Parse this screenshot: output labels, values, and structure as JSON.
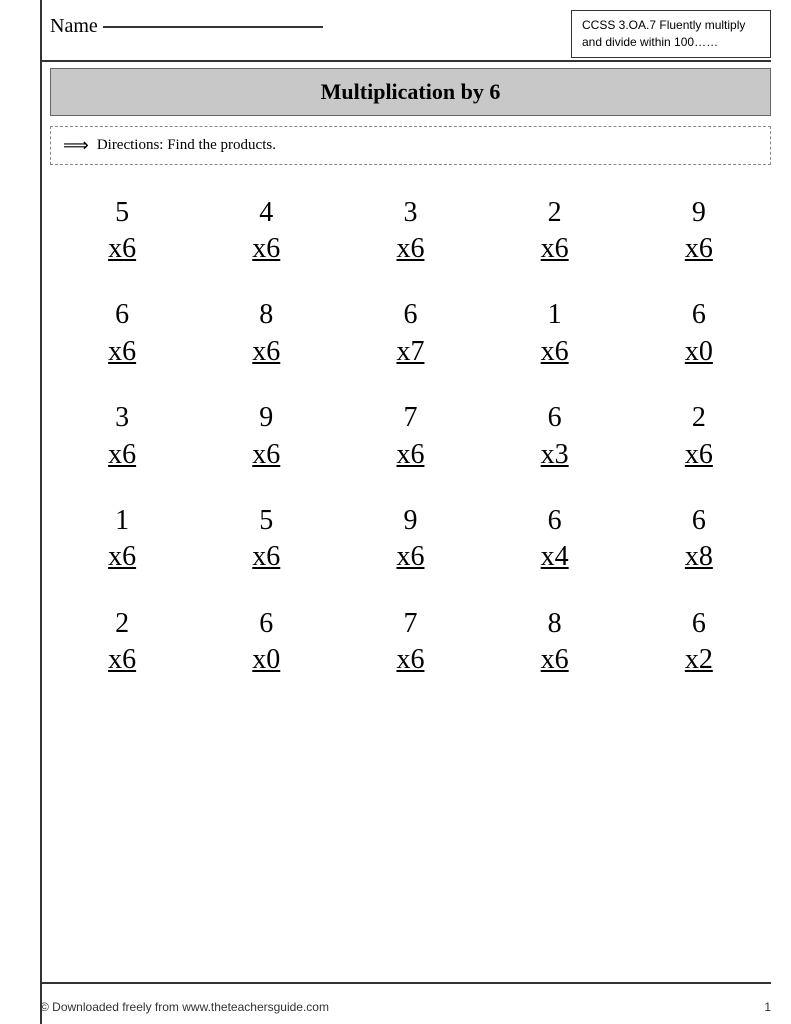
{
  "header": {
    "name_label": "Name",
    "standards_text": "CCSS 3.OA.7 Fluently multiply and divide  within 100……"
  },
  "title": "Multiplication by 6",
  "directions": "Directions: Find the products.",
  "rows": [
    [
      {
        "top": "5",
        "bottom": "x6"
      },
      {
        "top": "4",
        "bottom": "x6"
      },
      {
        "top": "3",
        "bottom": "x6"
      },
      {
        "top": "2",
        "bottom": "x6"
      },
      {
        "top": "9",
        "bottom": "x6"
      }
    ],
    [
      {
        "top": "6",
        "bottom": "x6"
      },
      {
        "top": "8",
        "bottom": "x6"
      },
      {
        "top": "6",
        "bottom": "x7"
      },
      {
        "top": "1",
        "bottom": "x6"
      },
      {
        "top": "6",
        "bottom": "x0"
      }
    ],
    [
      {
        "top": "3",
        "bottom": "x6"
      },
      {
        "top": "9",
        "bottom": "x6"
      },
      {
        "top": "7",
        "bottom": "x6"
      },
      {
        "top": "6",
        "bottom": "x3"
      },
      {
        "top": "2",
        "bottom": "x6"
      }
    ],
    [
      {
        "top": "1",
        "bottom": "x6"
      },
      {
        "top": "5",
        "bottom": "x6"
      },
      {
        "top": "9",
        "bottom": "x6"
      },
      {
        "top": "6",
        "bottom": "x4"
      },
      {
        "top": "6",
        "bottom": "x8"
      }
    ],
    [
      {
        "top": "2",
        "bottom": "x6"
      },
      {
        "top": "6",
        "bottom": "x0"
      },
      {
        "top": "7",
        "bottom": "x6"
      },
      {
        "top": "8",
        "bottom": "x6"
      },
      {
        "top": "6",
        "bottom": "x2"
      }
    ]
  ],
  "footer": {
    "copyright": "© Downloaded freely from www.theteachersguide.com",
    "page_number": "1"
  }
}
